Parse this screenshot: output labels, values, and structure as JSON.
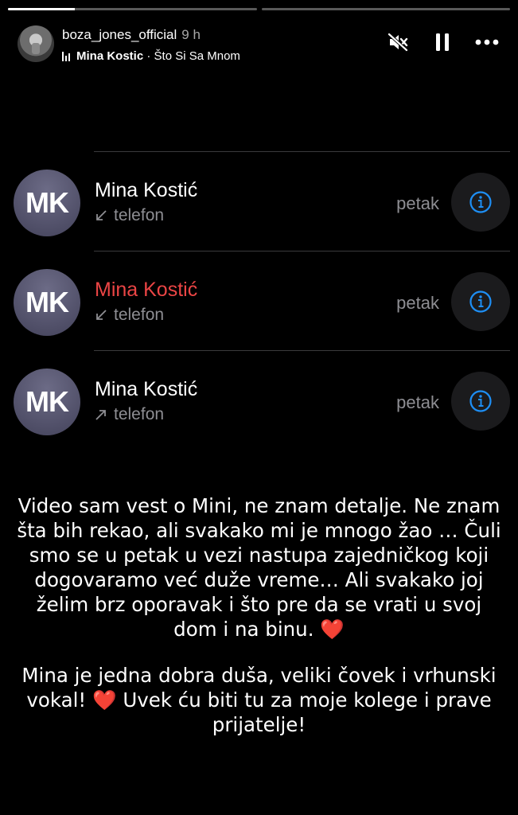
{
  "progress": [
    {
      "fill": 0.27
    },
    {
      "fill": 0
    }
  ],
  "story": {
    "username": "boza_jones_official",
    "time": "9 h",
    "music_artist": "Mina Kostic",
    "music_separator": " · ",
    "music_title": "Što Si Sa Mnom"
  },
  "icons": {
    "mute": "speaker-muted-icon",
    "pause": "pause-icon",
    "more": "more-dots-icon",
    "incoming": "arrow-incoming-icon",
    "outgoing": "arrow-outgoing-icon",
    "info": "info-icon"
  },
  "calls": [
    {
      "initials": "MK",
      "name": "Mina Kostić",
      "missed": false,
      "direction": "incoming",
      "type": "telefon",
      "day": "petak"
    },
    {
      "initials": "MK",
      "name": "Mina Kostić",
      "missed": true,
      "direction": "incoming",
      "type": "telefon",
      "day": "petak"
    },
    {
      "initials": "MK",
      "name": "Mina Kostić",
      "missed": false,
      "direction": "outgoing",
      "type": "telefon",
      "day": "petak"
    }
  ],
  "colors": {
    "missed": "#eb4545",
    "info_accent": "#1e8ff5",
    "heart": "#e0102a"
  },
  "message": {
    "paragraph1": "Video sam vest o Mini, ne znam detalje. Ne znam šta bih rekao, ali svakako mi je mnogo žao … Čuli smo se u petak u vezi nastupa zajedničkog koji dogovaramo već duže vreme… Ali svakako joj želim brz oporavak i što pre da se vrati u svoj dom i na binu.",
    "paragraph2_a": "Mina je jedna dobra duša, veliki čovek i vrhunski vokal!",
    "paragraph2_b": "Uvek ću biti tu za moje kolege i prave prijatelje!",
    "heart": "❤️"
  }
}
